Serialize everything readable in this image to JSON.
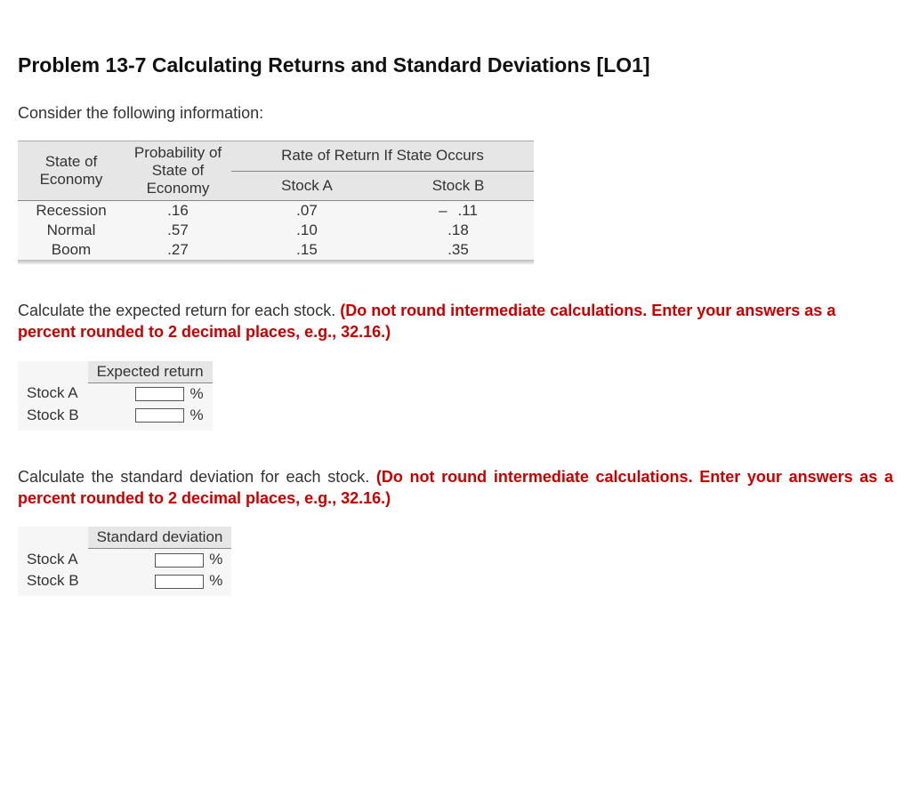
{
  "title": "Problem 13-7 Calculating Returns and Standard Deviations [LO1]",
  "intro": "Consider the following information:",
  "infoTable": {
    "topSpanner": "Rate of Return If State Occurs",
    "col1": "State of Economy",
    "col2": "Probability of State of Economy",
    "col3": "Stock A",
    "col4": "Stock B",
    "rows": [
      {
        "state": "Recession",
        "prob": ".16",
        "a": ".07",
        "b_neg": "–",
        "b_val": ".11"
      },
      {
        "state": "Normal",
        "prob": ".57",
        "a": ".10",
        "b_neg": "",
        "b_val": ".18"
      },
      {
        "state": "Boom",
        "prob": ".27",
        "a": ".15",
        "b_neg": "",
        "b_val": ".35"
      }
    ]
  },
  "q1": {
    "black": "Calculate the expected return for each stock. ",
    "red": "(Do not round intermediate calculations. Enter your answers as a percent rounded to 2 decimal places, e.g., 32.16.)"
  },
  "expTable": {
    "header": "Expected return",
    "rowA": "Stock A",
    "rowB": "Stock B",
    "pct": "%"
  },
  "q2": {
    "black": "Calculate the standard deviation for each stock. ",
    "red": "(Do not round intermediate calculations. Enter your answers as a percent rounded to 2 decimal places, e.g., 32.16.)"
  },
  "sdTable": {
    "header": "Standard deviation",
    "rowA": "Stock A",
    "rowB": "Stock B",
    "pct": "%"
  }
}
